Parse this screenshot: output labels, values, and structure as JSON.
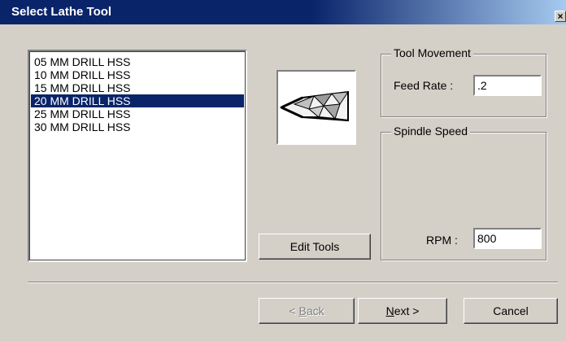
{
  "window": {
    "title": "Select Lathe Tool",
    "close_glyph": "×"
  },
  "tool_list": {
    "items": [
      "05 MM DRILL HSS",
      "10 MM DRILL HSS",
      "15 MM DRILL HSS",
      "20 MM DRILL HSS",
      "25 MM DRILL HSS",
      "30 MM DRILL HSS"
    ],
    "selected_index": 3
  },
  "preview": {
    "icon": "drill-bit-icon"
  },
  "edit_tools_label": "Edit Tools",
  "tool_movement": {
    "label": "Tool Movement",
    "feed_rate_label": "Feed Rate :",
    "feed_rate_value": ".2"
  },
  "spindle_speed": {
    "label": "Spindle Speed",
    "rpm_label": "RPM :",
    "rpm_value": "800"
  },
  "buttons": {
    "back_mnemonic": "B",
    "back_rest": "ack",
    "back_prefix": "< ",
    "next_mnemonic": "N",
    "next_rest": "ext >",
    "cancel": "Cancel"
  },
  "colors": {
    "face": "#d4d0c8",
    "title_active": "#0a246a",
    "selection": "#0a246a"
  }
}
